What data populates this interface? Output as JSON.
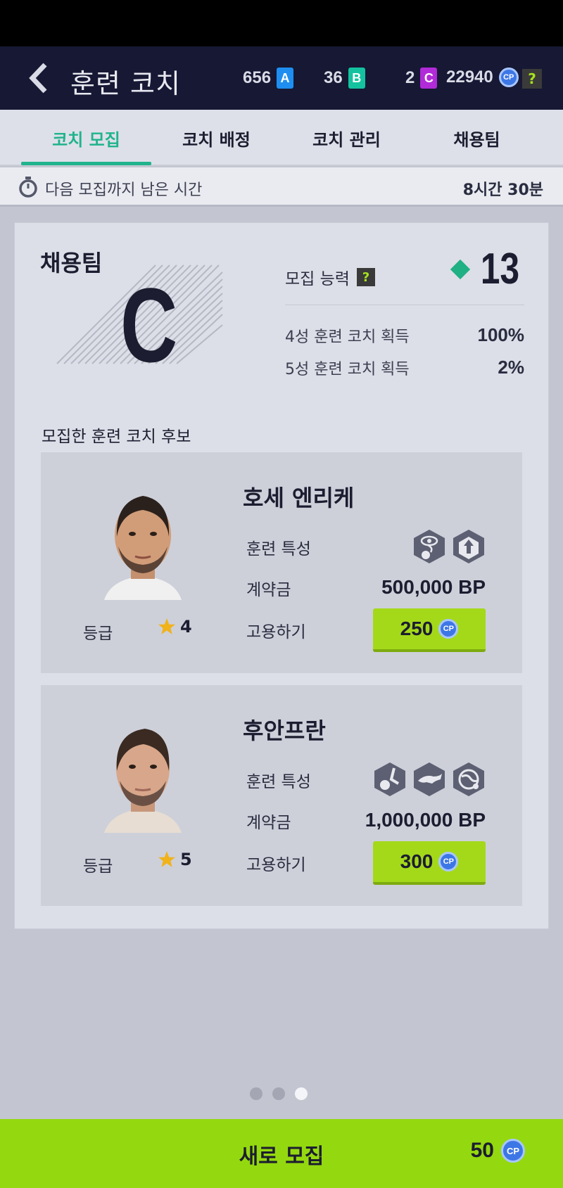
{
  "header": {
    "title": "훈련 코치",
    "currencies": [
      {
        "value": "656",
        "ticket": "A",
        "color": "#1e8ff0"
      },
      {
        "value": "36",
        "ticket": "B",
        "color": "#14c29f"
      },
      {
        "value": "2",
        "ticket": "C",
        "color": "#b12bd8"
      }
    ],
    "cp_value": "22940",
    "cp_label": "CP",
    "help": "?"
  },
  "tabs": [
    {
      "label": "코치 모집",
      "active": true
    },
    {
      "label": "코치 배정",
      "active": false
    },
    {
      "label": "코치 관리",
      "active": false
    },
    {
      "label": "채용팀",
      "active": false
    }
  ],
  "timer": {
    "label": "다음 모집까지 남은 시간",
    "value": "8시간 30분"
  },
  "team": {
    "label": "채용팀",
    "grade": "C",
    "ability_label": "모집 능력",
    "ability_help": "?",
    "ability_value": "13",
    "probabilities": [
      {
        "label": "4성 훈련 코치 획득",
        "value": "100%"
      },
      {
        "label": "5성 훈련 코치 획득",
        "value": "2%"
      }
    ]
  },
  "candidates": {
    "label": "모집한 훈련 코치 후보",
    "items": [
      {
        "name": "호세 엔리케",
        "grade_label": "등급",
        "stars": "4",
        "trait_label": "훈련 특성",
        "traits": [
          "eye-ball-trait-icon",
          "upgrade-arrow-trait-icon"
        ],
        "contract_label": "계약금",
        "contract": "500,000 BP",
        "hire_label": "고용하기",
        "hire_cost": "250"
      },
      {
        "name": "후안프란",
        "grade_label": "등급",
        "stars": "5",
        "trait_label": "훈련 특성",
        "traits": [
          "kick-trait-icon",
          "sprint-trait-icon",
          "globe-trait-icon"
        ],
        "contract_label": "계약금",
        "contract": "1,000,000 BP",
        "hire_label": "고용하기",
        "hire_cost": "300"
      }
    ]
  },
  "pagination": {
    "count": 3,
    "active": 2
  },
  "bottom": {
    "label": "새로 모집",
    "cost": "50",
    "cp_label": "CP"
  },
  "colors": {
    "accent": "#20b38c",
    "header_bg": "#161834",
    "button_green": "#a4d91a",
    "bottom_bar": "#94d90f",
    "star": "#f1b21a"
  }
}
